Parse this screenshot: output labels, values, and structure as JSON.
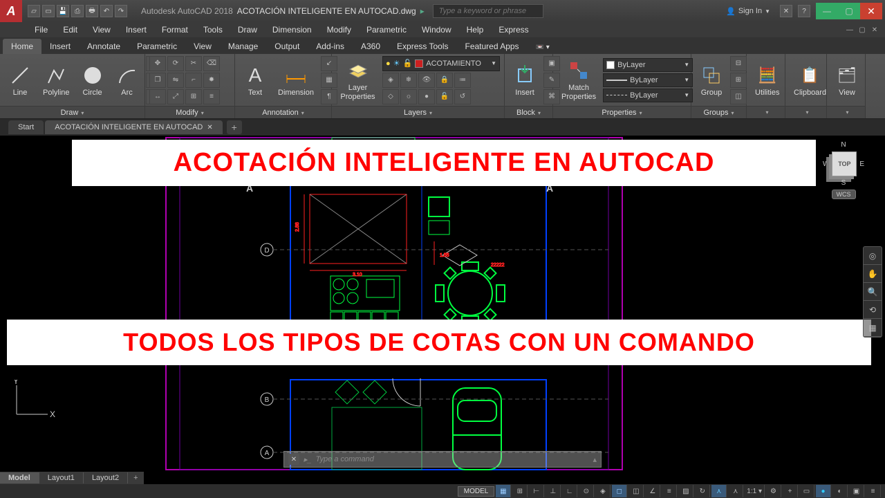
{
  "title": {
    "app": "Autodesk AutoCAD 2018",
    "filename": "ACOTACIÓN INTELIGENTE EN AUTOCAD.dwg",
    "search_placeholder": "Type a keyword or phrase",
    "signin": "Sign In"
  },
  "menus": [
    "File",
    "Edit",
    "View",
    "Insert",
    "Format",
    "Tools",
    "Draw",
    "Dimension",
    "Modify",
    "Parametric",
    "Window",
    "Help",
    "Express"
  ],
  "ribbon_tabs": [
    "Home",
    "Insert",
    "Annotate",
    "Parametric",
    "View",
    "Manage",
    "Output",
    "Add-ins",
    "A360",
    "Express Tools",
    "Featured Apps"
  ],
  "active_ribbon_tab": "Home",
  "panels": {
    "draw": {
      "title": "Draw",
      "tools": [
        "Line",
        "Polyline",
        "Circle",
        "Arc"
      ]
    },
    "modify": {
      "title": "Modify"
    },
    "annotation": {
      "title": "Annotation",
      "tools": [
        "Text",
        "Dimension"
      ]
    },
    "layers": {
      "title": "Layers",
      "tool": "Layer Properties",
      "current": "ACOTAMIENTO"
    },
    "block": {
      "title": "Block",
      "tools": [
        "Insert"
      ]
    },
    "properties": {
      "title": "Properties",
      "tool": "Match Properties",
      "bylayer": "ByLayer"
    },
    "groups": {
      "title": "Groups",
      "tool": "Group"
    },
    "utilities": {
      "title": "Utilities"
    },
    "clipboard": {
      "title": "Clipboard"
    },
    "view": {
      "title": "View"
    }
  },
  "doc_tabs": {
    "start": "Start",
    "file": "ACOTACIÓN INTELIGENTE EN AUTOCAD"
  },
  "banners": {
    "line1": "ACOTACIÓN INTELIGENTE EN AUTOCAD",
    "line2": "TODOS LOS TIPOS DE COTAS CON UN COMANDO"
  },
  "viewcube": {
    "n": "N",
    "s": "S",
    "e": "E",
    "w": "W",
    "top": "TOP",
    "wcs": "WCS"
  },
  "ucs": {
    "x": "X",
    "y": "Y"
  },
  "cmdline": {
    "placeholder": "Type a command"
  },
  "layout_tabs": [
    "Model",
    "Layout1",
    "Layout2"
  ],
  "status": {
    "model": "MODEL",
    "scale": "1:1"
  },
  "markers": {
    "a": "A",
    "b": "B",
    "d": "D"
  },
  "dims": {
    "h1": "2.88",
    "w1": "3.10",
    "h2": "1.55",
    "w2": "22222"
  }
}
